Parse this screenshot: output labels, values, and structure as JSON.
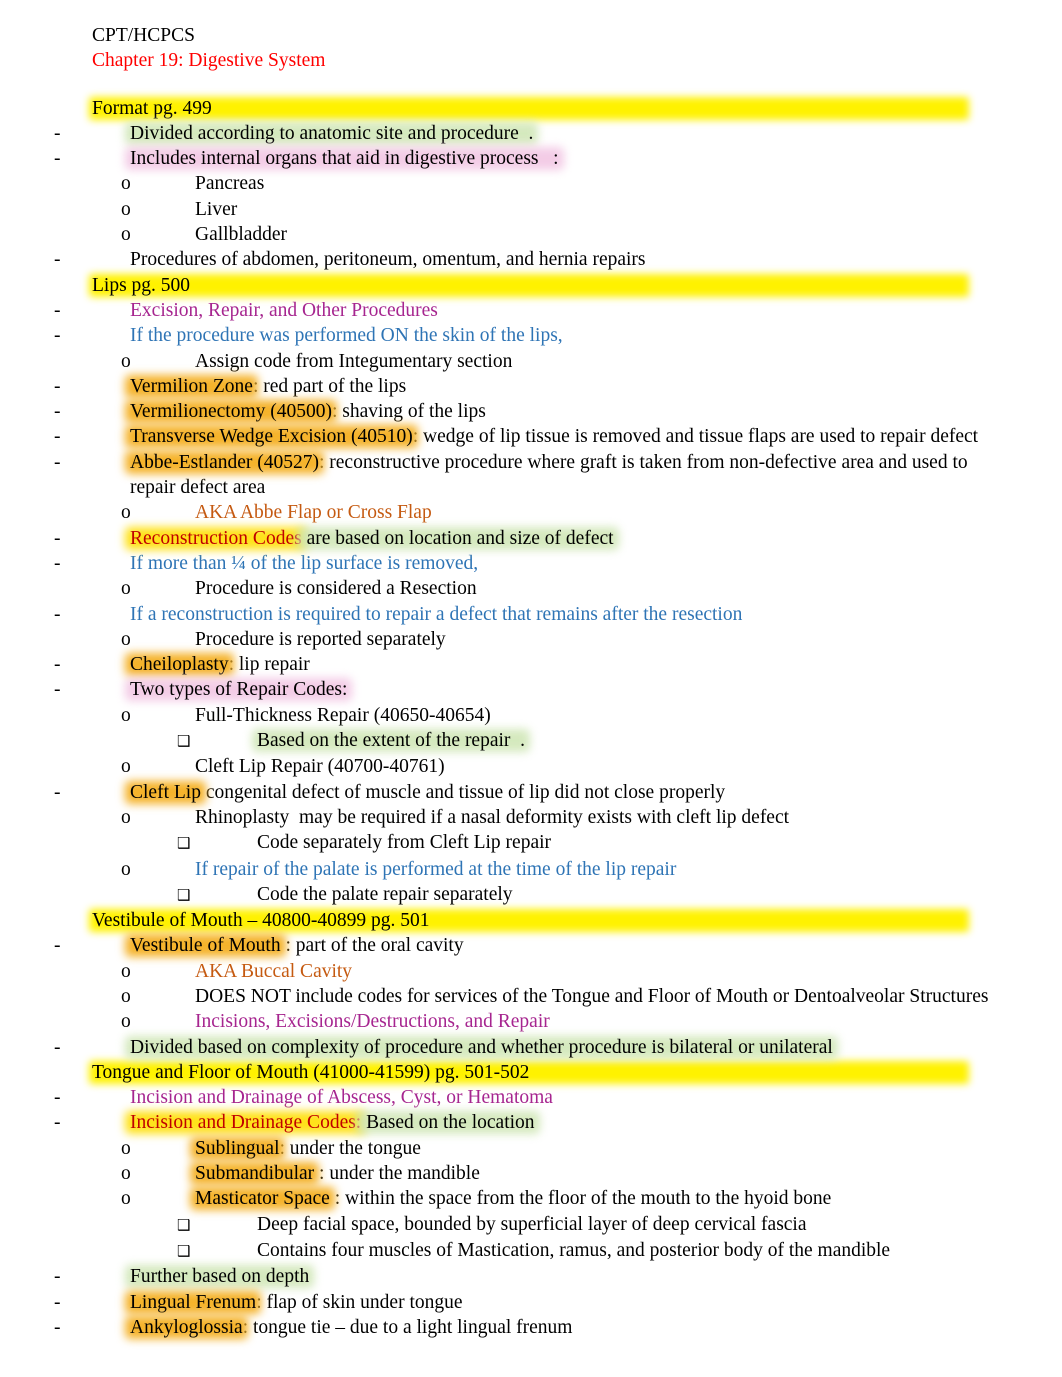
{
  "document": {
    "course": "CPT/HCPCS",
    "chapter": "Chapter 19: Digestive System"
  },
  "colors": {
    "chapter_red": "#FF0000",
    "term_red": "#C00000",
    "blue": "#2E74B5",
    "purple": "#A6258F",
    "orange": "#C55A11",
    "highlight_yellow": "#FFF200",
    "highlight_gold": "#F5B32B",
    "highlight_green": "#CFE6B5",
    "highlight_pink": "#F2C7E4"
  },
  "markers": {
    "dash": "-",
    "circle": "o",
    "box": "❑"
  },
  "sections": [
    {
      "heading": "Format pg. 499",
      "lines": [
        {
          "marker": "-",
          "level": 1,
          "text": "Divided according to anatomic site and procedure  ."
        },
        {
          "marker": "-",
          "level": 1,
          "text": "Includes internal organs that aid in digestive process   :"
        },
        {
          "marker": "o",
          "level": 2,
          "text": "Pancreas"
        },
        {
          "marker": "o",
          "level": 2,
          "text": "Liver"
        },
        {
          "marker": "o",
          "level": 2,
          "text": "Gallbladder"
        },
        {
          "marker": "-",
          "level": 1,
          "text": "Procedures of abdomen, peritoneum, omentum, and hernia repairs"
        }
      ]
    },
    {
      "heading": "Lips pg. 500",
      "lines": [
        {
          "marker": "-",
          "level": 1,
          "text": "Excision, Repair, and Other Procedures"
        },
        {
          "marker": "-",
          "level": 1,
          "text": "If the procedure was performed ON the skin of the lips,"
        },
        {
          "marker": "o",
          "level": 2,
          "text": "Assign code from Integumentary section"
        },
        {
          "marker": "-",
          "level": 1,
          "term": "Vermilion Zone",
          "text": ": red part of the lips"
        },
        {
          "marker": "-",
          "level": 1,
          "term": "Vermilionectomy (40500)",
          "text": ": shaving of the lips"
        },
        {
          "marker": "-",
          "level": 1,
          "term": "Transverse Wedge Excision (40510)",
          "text": ": wedge of lip tissue is removed and tissue flaps are used to repair defect"
        },
        {
          "marker": "-",
          "level": 1,
          "term": "Abbe-Estlander (40527)",
          "text": ": reconstructive procedure where graft is taken from non-defective area and used to repair defect area"
        },
        {
          "marker": "o",
          "level": 2,
          "text": "AKA Abbe Flap or Cross Flap"
        },
        {
          "marker": "-",
          "level": 1,
          "term": "Reconstruction Codes",
          "text": " are based on location and size of defect"
        },
        {
          "marker": "-",
          "level": 1,
          "text": "If more than ¼ of the lip surface is removed,"
        },
        {
          "marker": "o",
          "level": 2,
          "text": "Procedure is considered a Resection"
        },
        {
          "marker": "-",
          "level": 1,
          "text": "If a reconstruction is required to repair a defect that remains after the resection"
        },
        {
          "marker": "o",
          "level": 2,
          "text": "Procedure is reported separately"
        },
        {
          "marker": "-",
          "level": 1,
          "term": "Cheiloplasty",
          "text": ": lip repair"
        },
        {
          "marker": "-",
          "level": 1,
          "text": "Two types of Repair Codes:"
        },
        {
          "marker": "o",
          "level": 2,
          "text": "Full-Thickness Repair (40650-40654)"
        },
        {
          "marker": "box",
          "level": 3,
          "text": "Based on the extent of the repair  ."
        },
        {
          "marker": "o",
          "level": 2,
          "text": "Cleft Lip Repair (40700-40761)"
        },
        {
          "marker": "-",
          "level": 1,
          "term": "Cleft Lip",
          "text": " congenital defect of muscle and tissue of lip did not close properly"
        },
        {
          "marker": "o",
          "level": 2,
          "text": "Rhinoplasty  may be required if a nasal deformity exists with cleft lip defect"
        },
        {
          "marker": "box",
          "level": 3,
          "text": "Code separately from Cleft Lip repair"
        },
        {
          "marker": "o",
          "level": 2,
          "text": "If repair of the palate is performed at the time of the lip repair"
        },
        {
          "marker": "box",
          "level": 3,
          "text": "Code the palate repair separately"
        }
      ]
    },
    {
      "heading": "Vestibule of Mouth – 40800-40899 pg. 501",
      "lines": [
        {
          "marker": "-",
          "level": 1,
          "term": "Vestibule of Mouth",
          "text": " : part of the oral cavity"
        },
        {
          "marker": "o",
          "level": 2,
          "text": "AKA Buccal Cavity"
        },
        {
          "marker": "o",
          "level": 2,
          "text": "DOES NOT include codes for services of the Tongue and Floor of Mouth or Dentoalveolar Structures"
        },
        {
          "marker": "o",
          "level": 2,
          "text": "Incisions, Excisions/Destructions, and Repair"
        },
        {
          "marker": "-",
          "level": 1,
          "text": "Divided based on complexity of procedure and whether procedure is bilateral or unilateral"
        }
      ]
    },
    {
      "heading": "Tongue and Floor of Mouth (41000-41599) pg. 501-502",
      "lines": [
        {
          "marker": "-",
          "level": 1,
          "text": "Incision and Drainage of Abscess, Cyst, or Hematoma"
        },
        {
          "marker": "-",
          "level": 1,
          "term": "Incision and Drainage Codes:",
          "text": " Based on the location"
        },
        {
          "marker": "o",
          "level": 2,
          "term": "Sublingual",
          "text": ": under the tongue"
        },
        {
          "marker": "o",
          "level": 2,
          "term": "Submandibular",
          "text": " : under the mandible"
        },
        {
          "marker": "o",
          "level": 2,
          "term": "Masticator Space",
          "text": " : within the space from the floor of the mouth to the hyoid bone"
        },
        {
          "marker": "box",
          "level": 3,
          "text": "Deep facial space, bounded by superficial layer of deep cervical fascia"
        },
        {
          "marker": "box",
          "level": 3,
          "text": "Contains four muscles of Mastication, ramus, and posterior body of the mandible"
        },
        {
          "marker": "-",
          "level": 1,
          "text": "Further based on depth"
        },
        {
          "marker": "-",
          "level": 1,
          "term": "Lingual Frenum",
          "text": ": flap of skin under tongue"
        },
        {
          "marker": "-",
          "level": 1,
          "term": "Ankyloglossia",
          "text": ": tongue tie – due to a light lingual frenum"
        }
      ]
    }
  ]
}
